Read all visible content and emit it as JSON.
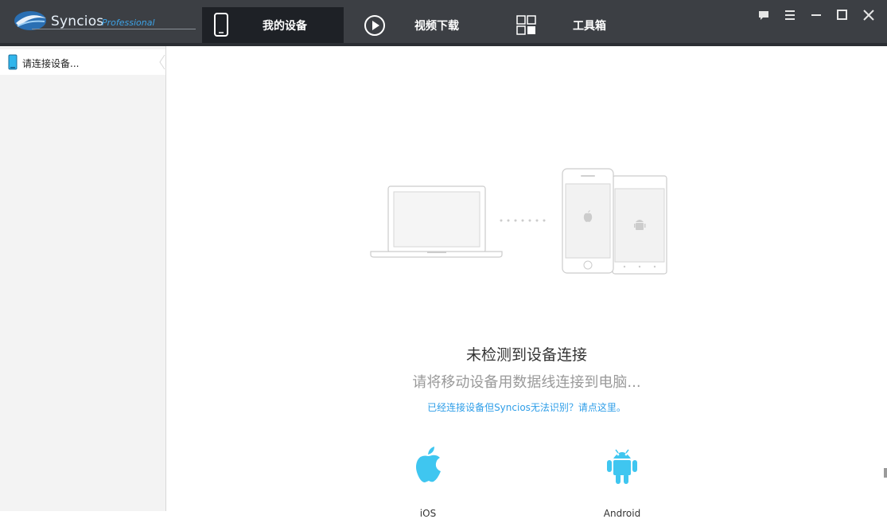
{
  "app": {
    "logo_name": "Syncios",
    "logo_edition": "Professional"
  },
  "nav": {
    "tabs": [
      {
        "label": "我的设备",
        "icon": "phone-icon",
        "active": true
      },
      {
        "label": "视频下载",
        "icon": "play-icon",
        "active": false
      },
      {
        "label": "工具箱",
        "icon": "grid-icon",
        "active": false
      }
    ]
  },
  "window_controls": [
    "feedback-icon",
    "menu-icon",
    "minimize-icon",
    "maximize-icon",
    "close-icon"
  ],
  "sidebar": {
    "items": [
      {
        "label": "请连接设备...",
        "icon": "phone-icon"
      }
    ]
  },
  "main": {
    "headline": "未检测到设备连接",
    "subline": "请将移动设备用数据线连接到电脑...",
    "help_link": "已经连接设备但Syncios无法识别？请点这里。",
    "platforms": [
      {
        "label": "iOS",
        "icon": "apple-icon",
        "color": "#3fc6f0"
      },
      {
        "label": "Android",
        "icon": "android-icon",
        "color": "#3fc6f0"
      }
    ]
  },
  "colors": {
    "topbar": "#3c3f44",
    "active_tab": "#1e2126",
    "accent": "#2f9ee8",
    "platform_icon": "#3fc6f0"
  }
}
